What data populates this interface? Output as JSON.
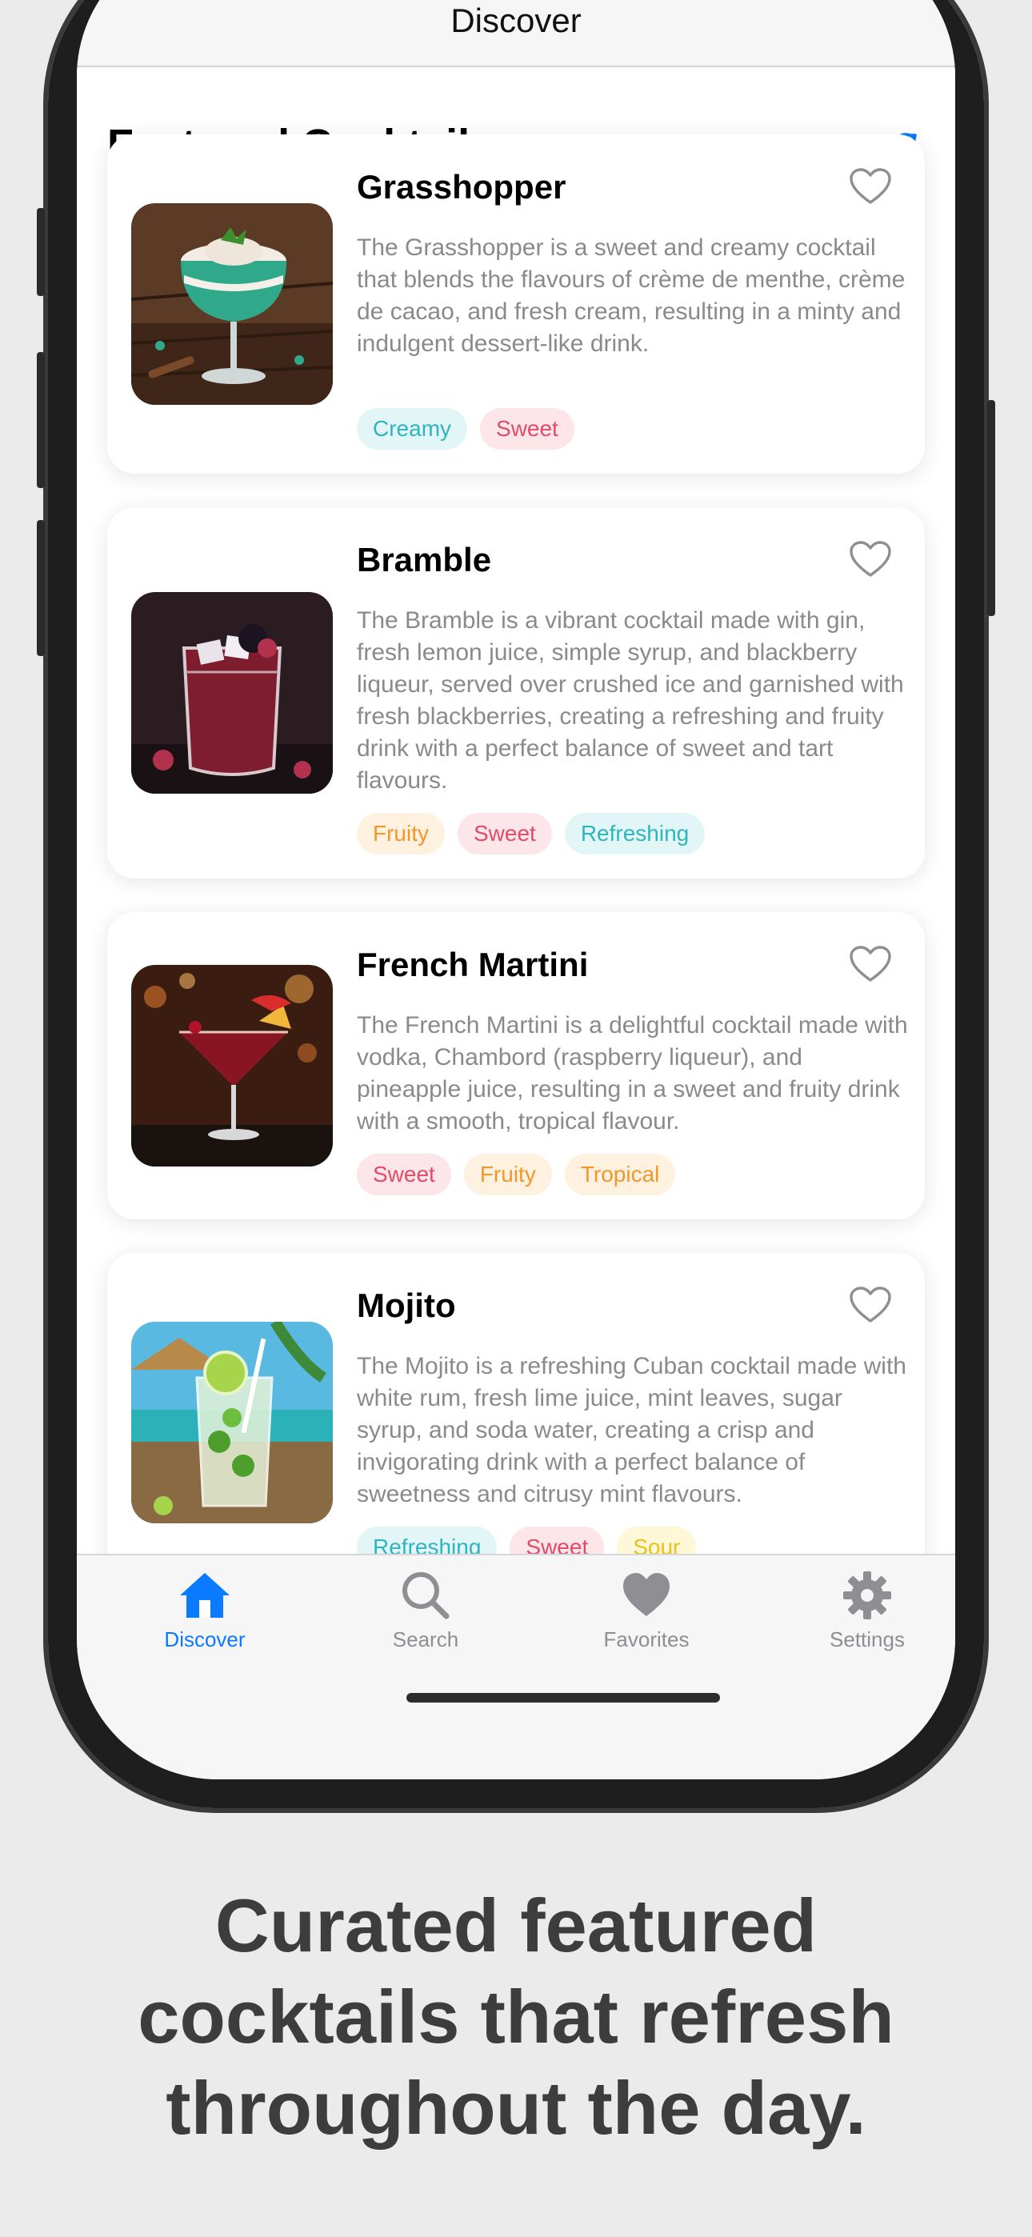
{
  "nav": {
    "title": "Discover"
  },
  "section": {
    "title": "Featured Cocktails",
    "refresh_icon": "refresh-icon"
  },
  "cocktails": [
    {
      "name": "Grasshopper",
      "description": "The Grasshopper is a sweet and creamy cocktail that blends the flavours of crème de menthe, crème de cacao, and fresh cream, resulting in a minty and indulgent dessert-like drink.",
      "tags": [
        "Creamy",
        "Sweet"
      ]
    },
    {
      "name": "Bramble",
      "description": "The Bramble is a vibrant cocktail made with gin, fresh lemon juice, simple syrup, and blackberry liqueur, served over crushed ice and garnished with fresh blackberries, creating a refreshing and fruity drink with a perfect balance of sweet and tart flavours.",
      "tags": [
        "Fruity",
        "Sweet",
        "Refreshing"
      ]
    },
    {
      "name": "French Martini",
      "description": "The French Martini is a delightful cocktail made with vodka, Chambord (raspberry liqueur), and pineapple juice, resulting in a sweet and fruity drink with a smooth, tropical flavour.",
      "tags": [
        "Sweet",
        "Fruity",
        "Tropical"
      ]
    },
    {
      "name": "Mojito",
      "description": "The Mojito is a refreshing Cuban cocktail made with white rum, fresh lime juice, mint leaves, sugar syrup, and soda water, creating a crisp and invigorating drink with a perfect balance of sweetness and citrusy mint flavours.",
      "tags": [
        "Refreshing",
        "Sweet",
        "Sour"
      ]
    }
  ],
  "tabbar": {
    "items": [
      {
        "label": "Discover",
        "icon": "house-icon",
        "active": true
      },
      {
        "label": "Search",
        "icon": "magnifier-icon",
        "active": false
      },
      {
        "label": "Favorites",
        "icon": "heart-icon",
        "active": false
      },
      {
        "label": "Settings",
        "icon": "gear-icon",
        "active": false
      }
    ]
  },
  "caption": {
    "line1": "Curated featured",
    "line2": "cocktails that refresh",
    "line3": "throughout the day."
  },
  "colors": {
    "accent": "#0a7aff",
    "tab_inactive": "#8e8e93",
    "tag_creamy_text": "#2fb5bf",
    "tag_sweet_text": "#e14b69",
    "tag_fruity_text": "#f0982c",
    "tag_sour_text": "#e9c21c"
  }
}
